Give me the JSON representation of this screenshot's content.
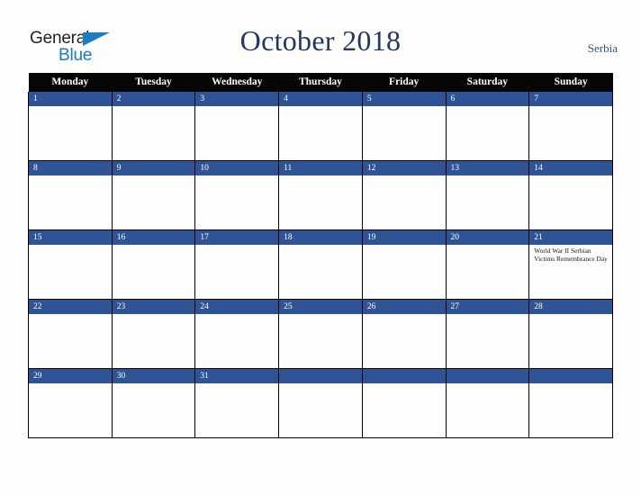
{
  "brand": {
    "word1": "General",
    "word2": "Blue",
    "triangle_color": "#1a7cc4",
    "word1_color": "#231f20",
    "word2_color": "#1a7cc4"
  },
  "header": {
    "title": "October 2018",
    "region": "Serbia",
    "title_color": "#26365e",
    "region_color": "#3c4f77"
  },
  "calendar": {
    "header_bg": "#060607",
    "header_text_color": "#ffffff",
    "daybar_bg": "#2f5496",
    "daybar_text_color": "#ffffff",
    "cell_bg": "#fdfdfd",
    "border_color": "#000000",
    "weekday_headers": [
      "Monday",
      "Tuesday",
      "Wednesday",
      "Thursday",
      "Friday",
      "Saturday",
      "Sunday"
    ],
    "weeks": [
      [
        {
          "day": "1",
          "events": []
        },
        {
          "day": "2",
          "events": []
        },
        {
          "day": "3",
          "events": []
        },
        {
          "day": "4",
          "events": []
        },
        {
          "day": "5",
          "events": []
        },
        {
          "day": "6",
          "events": []
        },
        {
          "day": "7",
          "events": []
        }
      ],
      [
        {
          "day": "8",
          "events": []
        },
        {
          "day": "9",
          "events": []
        },
        {
          "day": "10",
          "events": []
        },
        {
          "day": "11",
          "events": []
        },
        {
          "day": "12",
          "events": []
        },
        {
          "day": "13",
          "events": []
        },
        {
          "day": "14",
          "events": []
        }
      ],
      [
        {
          "day": "15",
          "events": []
        },
        {
          "day": "16",
          "events": []
        },
        {
          "day": "17",
          "events": []
        },
        {
          "day": "18",
          "events": []
        },
        {
          "day": "19",
          "events": []
        },
        {
          "day": "20",
          "events": []
        },
        {
          "day": "21",
          "events": [
            "World War II Serbian Victims Remembrance Day"
          ]
        }
      ],
      [
        {
          "day": "22",
          "events": []
        },
        {
          "day": "23",
          "events": []
        },
        {
          "day": "24",
          "events": []
        },
        {
          "day": "25",
          "events": []
        },
        {
          "day": "26",
          "events": []
        },
        {
          "day": "27",
          "events": []
        },
        {
          "day": "28",
          "events": []
        }
      ],
      [
        {
          "day": "29",
          "events": []
        },
        {
          "day": "30",
          "events": []
        },
        {
          "day": "31",
          "events": []
        },
        {
          "day": "",
          "events": []
        },
        {
          "day": "",
          "events": []
        },
        {
          "day": "",
          "events": []
        },
        {
          "day": "",
          "events": []
        }
      ]
    ]
  }
}
